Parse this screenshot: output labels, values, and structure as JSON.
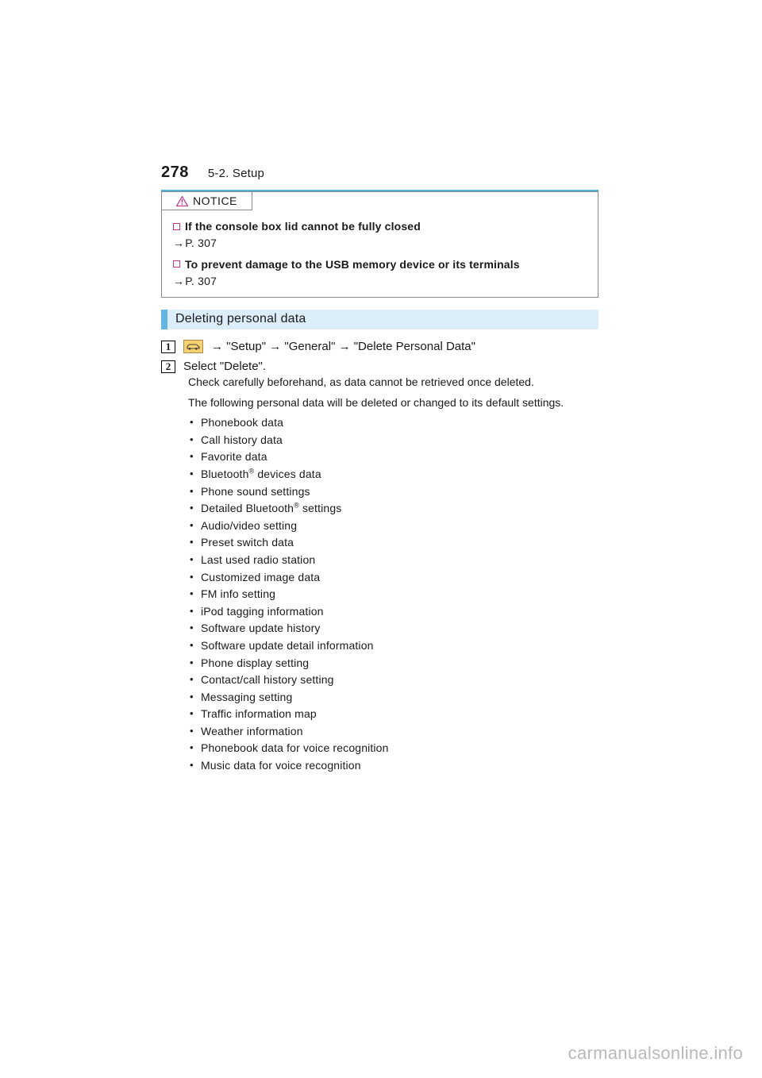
{
  "page_number": "278",
  "section_label": "5-2. Setup",
  "notice": {
    "tab_label": "NOTICE",
    "items": [
      {
        "heading": "If the console box lid cannot be fully closed",
        "ref": "P. 307"
      },
      {
        "heading": "To prevent damage to the USB memory device or its terminals",
        "ref": "P. 307"
      }
    ]
  },
  "section_heading": "Deleting personal data",
  "step1": {
    "path": [
      "\"Setup\"",
      "\"General\"",
      "\"Delete Personal Data\""
    ]
  },
  "step2": {
    "text": "Select \"Delete\"."
  },
  "sub": {
    "note1": "Check carefully beforehand, as data cannot be retrieved once deleted.",
    "note2": "The following personal data will be deleted or changed to its default settings.",
    "bullets": [
      "Phonebook data",
      "Call history data",
      "Favorite data",
      "Bluetooth® devices data",
      "Phone sound settings",
      "Detailed Bluetooth® settings",
      "Audio/video setting",
      "Preset switch data",
      "Last used radio station",
      "Customized image data",
      "FM info setting",
      "iPod tagging information",
      "Software update history",
      "Software update detail information",
      "Phone display setting",
      "Contact/call history setting",
      "Messaging setting",
      "Traffic information map",
      "Weather information",
      "Phonebook data for voice recognition",
      "Music data for voice recognition"
    ]
  },
  "watermark": "carmanualsonline.info"
}
